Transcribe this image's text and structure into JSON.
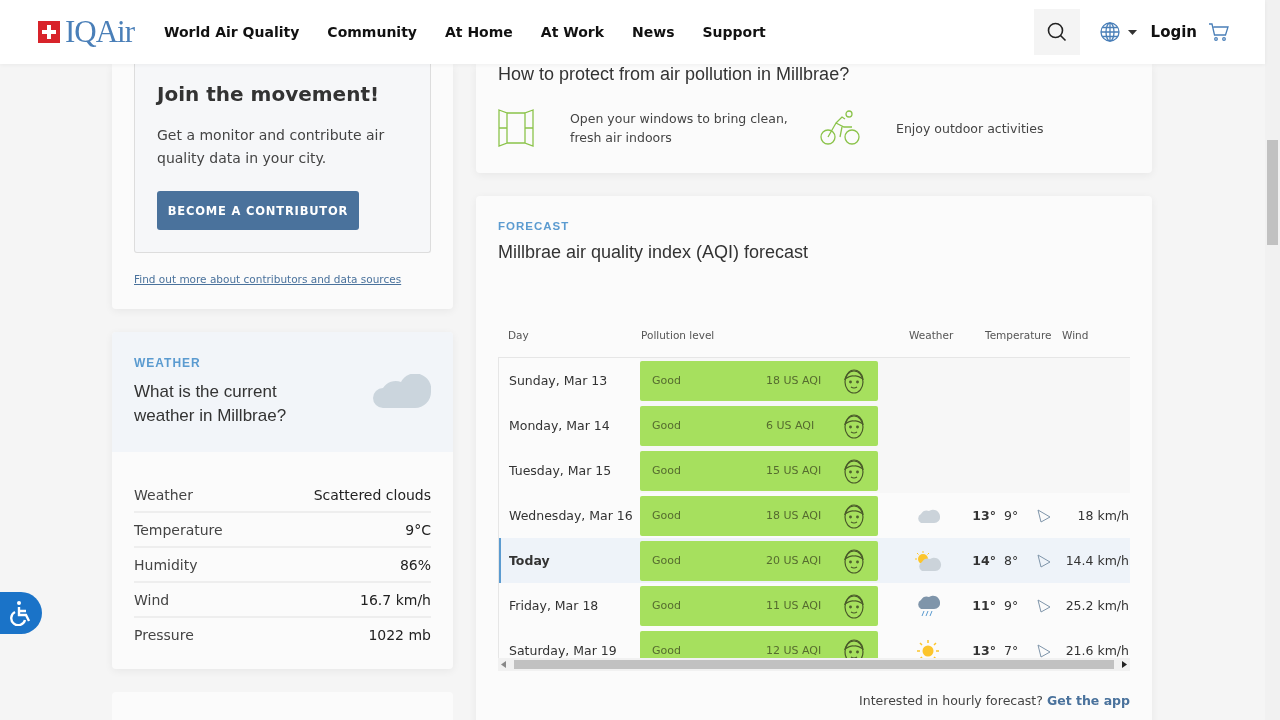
{
  "header": {
    "logo": "IQAir",
    "nav": [
      "World Air Quality",
      "Community",
      "At Home",
      "At Work",
      "News",
      "Support"
    ],
    "login": "Login"
  },
  "join": {
    "title": "Join the movement!",
    "text": "Get a monitor and contribute air quality data in your city.",
    "button": "BECOME A CONTRIBUTOR",
    "link": "Find out more about contributors and data sources"
  },
  "weather": {
    "eyebrow": "WEATHER",
    "title": "What is the current weather in Millbrae?",
    "rows": [
      {
        "label": "Weather",
        "value": "Scattered clouds"
      },
      {
        "label": "Temperature",
        "value": "9°C"
      },
      {
        "label": "Humidity",
        "value": "86%"
      },
      {
        "label": "Wind",
        "value": "16.7 km/h"
      },
      {
        "label": "Pressure",
        "value": "1022 mb"
      }
    ]
  },
  "protect": {
    "title": "How to protect from air pollution in Millbrae?",
    "items": [
      {
        "kind": "window",
        "text": "Open your windows to bring clean, fresh air indoors"
      },
      {
        "kind": "bike",
        "text": "Enjoy outdoor activities"
      }
    ]
  },
  "forecast": {
    "eyebrow": "FORECAST",
    "title": "Millbrae air quality index (AQI) forecast",
    "columns": [
      "Day",
      "Pollution level",
      "Weather",
      "Temperature",
      "Wind"
    ],
    "rows": [
      {
        "day": "Sunday, Mar 13",
        "selected": false,
        "level": "Good",
        "aqi": "18 US AQI",
        "kind": "none"
      },
      {
        "day": "Monday, Mar 14",
        "selected": false,
        "level": "Good",
        "aqi": "6 US AQI",
        "kind": "none"
      },
      {
        "day": "Tuesday, Mar 15",
        "selected": false,
        "level": "Good",
        "aqi": "15 US AQI",
        "kind": "none"
      },
      {
        "day": "Wednesday, Mar 16",
        "selected": false,
        "level": "Good",
        "aqi": "18 US AQI",
        "kind": "cloud",
        "high": "13°",
        "low": "9°",
        "wind": "18 km/h"
      },
      {
        "day": "Today",
        "selected": true,
        "level": "Good",
        "aqi": "20 US AQI",
        "kind": "partly-cloudy",
        "high": "14°",
        "low": "8°",
        "wind": "14.4 km/h"
      },
      {
        "day": "Friday, Mar 18",
        "selected": false,
        "level": "Good",
        "aqi": "11 US AQI",
        "kind": "rain",
        "high": "11°",
        "low": "9°",
        "wind": "25.2 km/h"
      },
      {
        "day": "Saturday, Mar 19",
        "selected": false,
        "level": "Good",
        "aqi": "12 US AQI",
        "kind": "sun",
        "high": "13°",
        "low": "7°",
        "wind": "21.6 km/h"
      }
    ],
    "footer_text": "Interested in hourly forecast?",
    "footer_link": "Get the app"
  }
}
